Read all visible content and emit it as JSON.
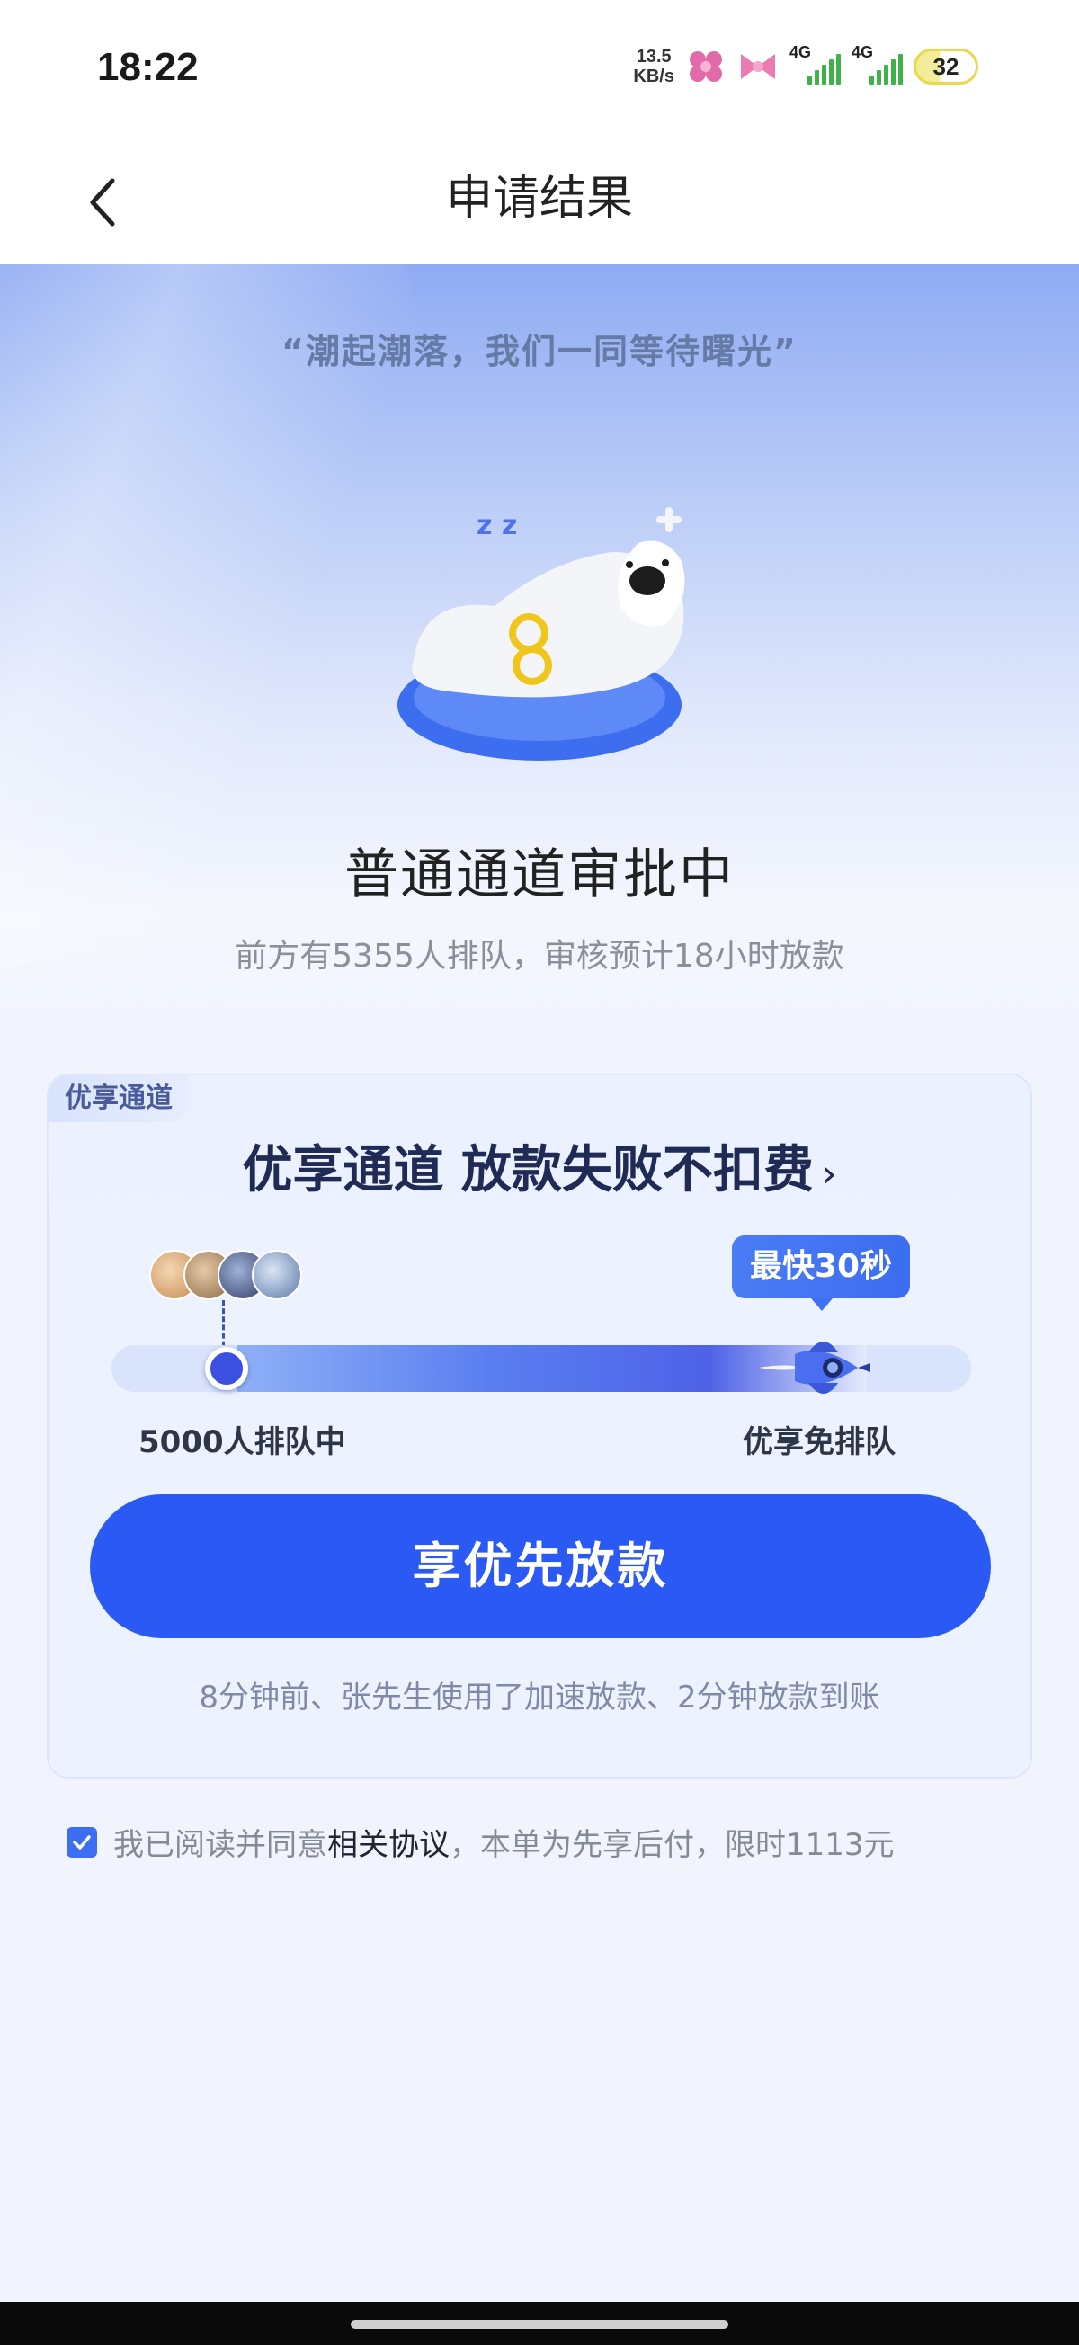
{
  "status_bar": {
    "time": "18:22",
    "net_speed_value": "13.5",
    "net_speed_unit": "KB/s",
    "signal1_tag": "4G",
    "signal2_tag": "4G",
    "battery": "32",
    "colors": {
      "signal": "#3fb24a",
      "battery_ring": "#e8d84a"
    }
  },
  "nav": {
    "back_icon": "chevron-left-icon",
    "title": "申请结果"
  },
  "hero": {
    "quote": "“潮起潮落，我们一同等待曙光”",
    "mascot": "seal-mascot-illustration",
    "title": "普通通道审批中",
    "subtitle": "前方有5355人排队，审核预计18小时放款"
  },
  "priority_card": {
    "tag": "优享通道",
    "title": "优享通道 放款失败不扣费",
    "title_chevron": "›",
    "badge": "最快30秒",
    "left_label": "5000人排队中",
    "right_label": "优享免排队",
    "cta": "享优先放款",
    "notice": "8分钟前、张先生使用了加速放款、2分钟放款到账",
    "colors": {
      "cta": "#2b59f3",
      "card_bg": "#ebf1fe"
    }
  },
  "agreement": {
    "checked": true,
    "prefix": "我已阅读并同意",
    "link": "相关协议",
    "suffix": "，本单为先享后付，限时1113元"
  }
}
